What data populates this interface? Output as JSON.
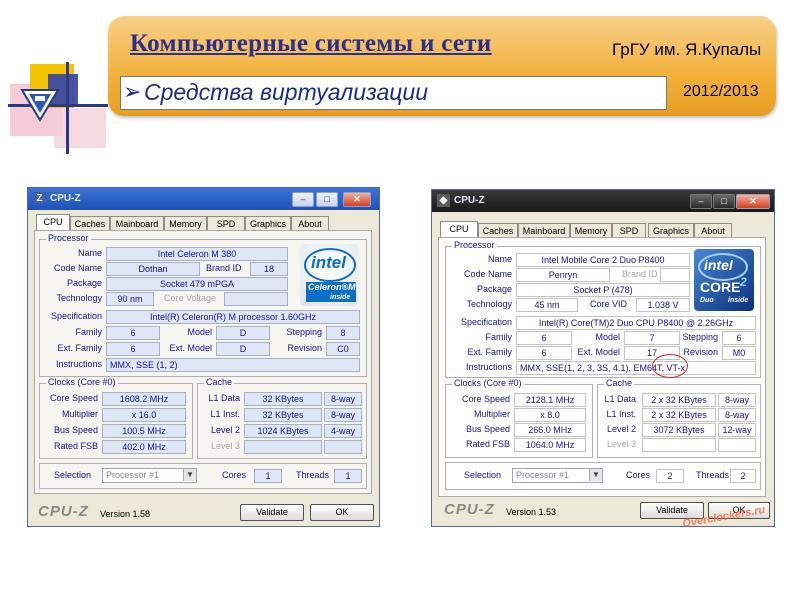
{
  "slide": {
    "title": "Компьютерные системы и сети",
    "university": "ГрГУ им. Я.Купалы",
    "bullet": "➢",
    "subtitle": "Средства  виртуализации",
    "year": "2012/2013",
    "colors": {
      "banner": "#f2b13a",
      "title_text": "#2b2f8f",
      "subtitle_text": "#1c2a8a"
    }
  },
  "windows": [
    {
      "title": "CPU-Z",
      "tabs": [
        "CPU",
        "Caches",
        "Mainboard",
        "Memory",
        "SPD",
        "Graphics",
        "About"
      ],
      "active_tab": "CPU",
      "processor": {
        "group_label": "Processor",
        "name_label": "Name",
        "name": "Intel Celeron M 380",
        "code_name_label": "Code Name",
        "code_name": "Dothan",
        "brand_id_label": "Brand ID",
        "brand_id": "18",
        "package_label": "Package",
        "package": "Socket 479 mPGA",
        "technology_label": "Technology",
        "technology": "90 nm",
        "core_voltage_label": "Core Voltage",
        "core_voltage": "",
        "specification_label": "Specification",
        "specification": "Intel(R) Celeron(R) M processor      1.60GHz",
        "family_label": "Family",
        "family": "6",
        "model_label": "Model",
        "model": "D",
        "stepping_label": "Stepping",
        "stepping": "8",
        "ext_family_label": "Ext. Family",
        "ext_family": "6",
        "ext_model_label": "Ext. Model",
        "ext_model": "D",
        "revision_label": "Revision",
        "revision": "C0",
        "instructions_label": "Instructions",
        "instructions": "MMX, SSE (1, 2)",
        "logo": {
          "word": "intel",
          "line1": "Celeron®M",
          "line2": "inside"
        }
      },
      "clocks": {
        "group_label": "Clocks (Core #0)",
        "core_speed_label": "Core Speed",
        "core_speed": "1608.2 MHz",
        "multiplier_label": "Multiplier",
        "multiplier": "x 16.0",
        "bus_speed_label": "Bus Speed",
        "bus_speed": "100.5 MHz",
        "rated_fsb_label": "Rated FSB",
        "rated_fsb": "402.0 MHz"
      },
      "cache": {
        "group_label": "Cache",
        "l1_data_label": "L1 Data",
        "l1_data": "32 KBytes",
        "l1_data_way": "8-way",
        "l1_inst_label": "L1 Inst.",
        "l1_inst": "32 KBytes",
        "l1_inst_way": "8-way",
        "level2_label": "Level 2",
        "level2": "1024 KBytes",
        "level2_way": "4-way",
        "level3_label": "Level 3"
      },
      "footer": {
        "selection_label": "Selection",
        "selection": "Processor #1",
        "cores_label": "Cores",
        "cores": "1",
        "threads_label": "Threads",
        "threads": "1",
        "brand": "CPU-Z",
        "version": "Version 1.58",
        "validate": "Validate",
        "ok": "OK"
      }
    },
    {
      "title": "CPU-Z",
      "tabs": [
        "CPU",
        "Caches",
        "Mainboard",
        "Memory",
        "SPD",
        "Graphics",
        "About"
      ],
      "active_tab": "CPU",
      "processor": {
        "group_label": "Processor",
        "name_label": "Name",
        "name": "Intel Mobile Core 2 Duo P8400",
        "code_name_label": "Code Name",
        "code_name": "Penryn",
        "brand_id_label": "Brand ID",
        "brand_id": "",
        "package_label": "Package",
        "package": "Socket P (478)",
        "technology_label": "Technology",
        "technology": "45 nm",
        "core_voltage_label": "Core VID",
        "core_voltage": "1.038 V",
        "specification_label": "Specification",
        "specification": "Intel(R) Core(TM)2 Duo CPU     P8400  @ 2.26GHz",
        "family_label": "Family",
        "family": "6",
        "model_label": "Model",
        "model": "7",
        "stepping_label": "Stepping",
        "stepping": "6",
        "ext_family_label": "Ext. Family",
        "ext_family": "6",
        "ext_model_label": "Ext. Model",
        "ext_model": "17",
        "revision_label": "Revision",
        "revision": "M0",
        "instructions_label": "Instructions",
        "instructions": "MMX, SSE(1, 2, 3, 3S, 4.1), EM64T, VT-x",
        "logo": {
          "word": "intel",
          "line1": "CORE",
          "line1b": "2",
          "line2": "Duo",
          "line3": "inside"
        }
      },
      "clocks": {
        "group_label": "Clocks (Core #0)",
        "core_speed_label": "Core Speed",
        "core_speed": "2128.1 MHz",
        "multiplier_label": "Multiplier",
        "multiplier": "x 8.0",
        "bus_speed_label": "Bus Speed",
        "bus_speed": "266.0 MHz",
        "rated_fsb_label": "Rated FSB",
        "rated_fsb": "1064.0 MHz"
      },
      "cache": {
        "group_label": "Cache",
        "l1_data_label": "L1 Data",
        "l1_data": "2 x 32 KBytes",
        "l1_data_way": "8-way",
        "l1_inst_label": "L1 Inst.",
        "l1_inst": "2 x 32 KBytes",
        "l1_inst_way": "8-way",
        "level2_label": "Level 2",
        "level2": "3072 KBytes",
        "level2_way": "12-way",
        "level3_label": "Level 3"
      },
      "footer": {
        "selection_label": "Selection",
        "selection": "Processor #1",
        "cores_label": "Cores",
        "cores": "2",
        "threads_label": "Threads",
        "threads": "2",
        "brand": "CPU-Z",
        "version": "Version 1.53",
        "validate": "Validate",
        "ok": "OK",
        "watermark": "Overclockers.ru"
      }
    }
  ]
}
